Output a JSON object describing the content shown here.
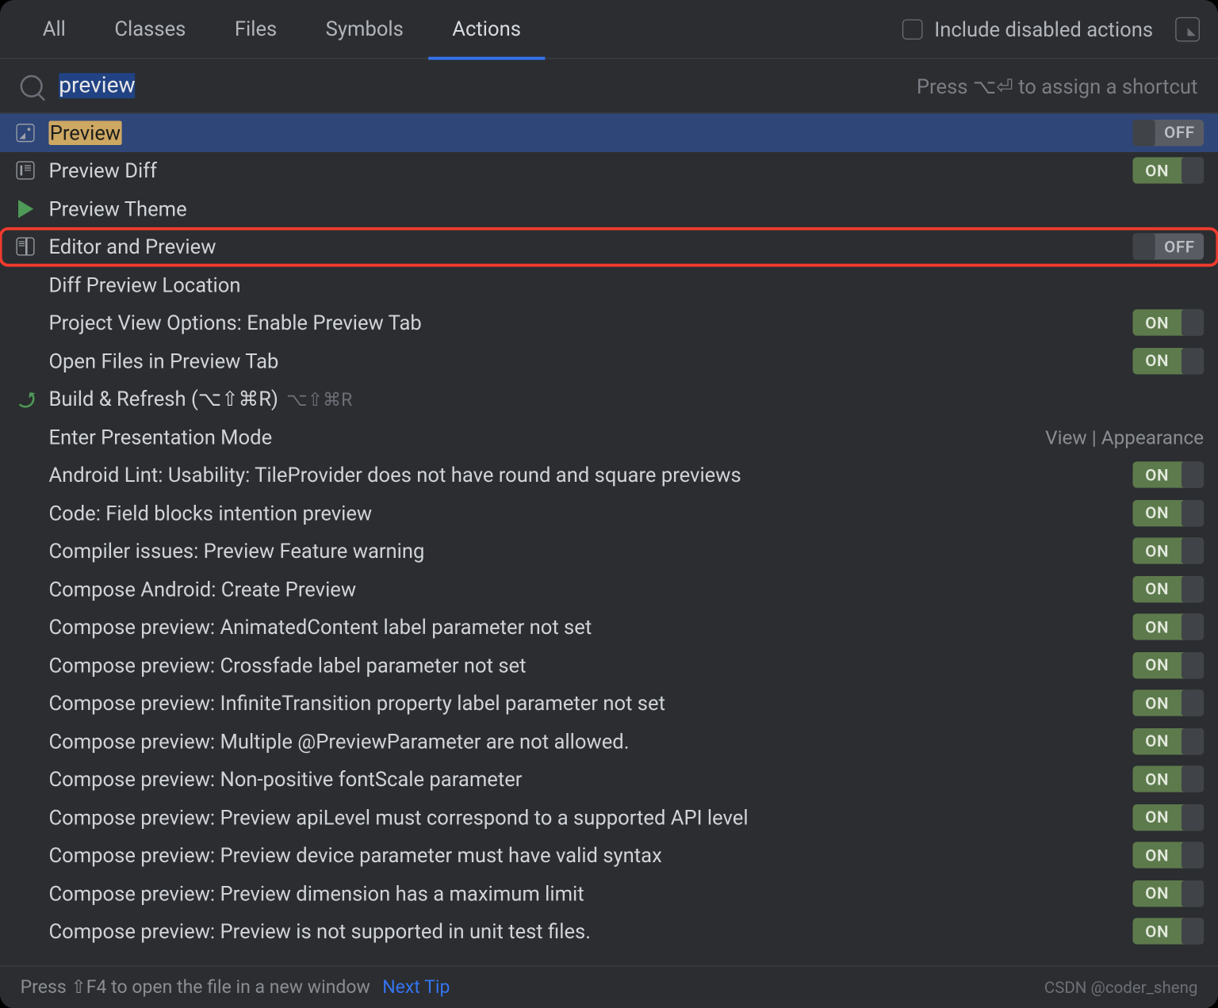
{
  "tabs": [
    "All",
    "Classes",
    "Files",
    "Symbols",
    "Actions"
  ],
  "active_tab": 4,
  "include_disabled_label": "Include disabled actions",
  "search": {
    "value": "preview",
    "hint": "Press ⌥⏎ to assign a shortcut"
  },
  "rows": [
    {
      "icon": "image",
      "label": "Preview",
      "highlight": "Preview",
      "toggle": "OFF",
      "selected": true
    },
    {
      "icon": "diff",
      "label": "Preview Diff",
      "toggle": "ON"
    },
    {
      "icon": "play",
      "label": "Preview Theme"
    },
    {
      "icon": "split",
      "label": "Editor and Preview",
      "toggle": "OFF",
      "boxed": true
    },
    {
      "icon": "",
      "label": "Diff Preview Location"
    },
    {
      "icon": "",
      "label": "Project View Options: Enable Preview Tab",
      "toggle": "ON"
    },
    {
      "icon": "",
      "label": "Open Files in Preview Tab",
      "toggle": "ON"
    },
    {
      "icon": "refresh",
      "label": "Build & Refresh (⌥⇧⌘R)",
      "shortcut_secondary": "⌥⇧⌘R"
    },
    {
      "icon": "",
      "label": "Enter Presentation Mode",
      "meta": "View | Appearance"
    },
    {
      "icon": "",
      "label": "Android Lint: Usability: TileProvider does not have round and square previews",
      "toggle": "ON"
    },
    {
      "icon": "",
      "label": "Code: Field blocks intention preview",
      "toggle": "ON"
    },
    {
      "icon": "",
      "label": "Compiler issues: Preview Feature warning",
      "toggle": "ON"
    },
    {
      "icon": "",
      "label": "Compose Android: Create Preview",
      "toggle": "ON"
    },
    {
      "icon": "",
      "label": "Compose preview: AnimatedContent label parameter not set",
      "toggle": "ON"
    },
    {
      "icon": "",
      "label": "Compose preview: Crossfade label parameter not set",
      "toggle": "ON"
    },
    {
      "icon": "",
      "label": "Compose preview: InfiniteTransition property label parameter not set",
      "toggle": "ON"
    },
    {
      "icon": "",
      "label": "Compose preview: Multiple @PreviewParameter are not allowed.",
      "toggle": "ON"
    },
    {
      "icon": "",
      "label": "Compose preview: Non-positive fontScale parameter",
      "toggle": "ON"
    },
    {
      "icon": "",
      "label": "Compose preview: Preview apiLevel must correspond to a supported API level",
      "toggle": "ON"
    },
    {
      "icon": "",
      "label": "Compose preview: Preview device parameter must have valid syntax",
      "toggle": "ON"
    },
    {
      "icon": "",
      "label": "Compose preview: Preview dimension has a maximum limit",
      "toggle": "ON"
    },
    {
      "icon": "",
      "label": "Compose preview: Preview is not supported in unit test files.",
      "toggle": "ON"
    }
  ],
  "footer": {
    "hint": "Press ⇧F4 to open the file in a new window",
    "next_tip": "Next Tip",
    "signature": "CSDN @coder_sheng"
  },
  "on_label": "ON",
  "off_label": "OFF"
}
